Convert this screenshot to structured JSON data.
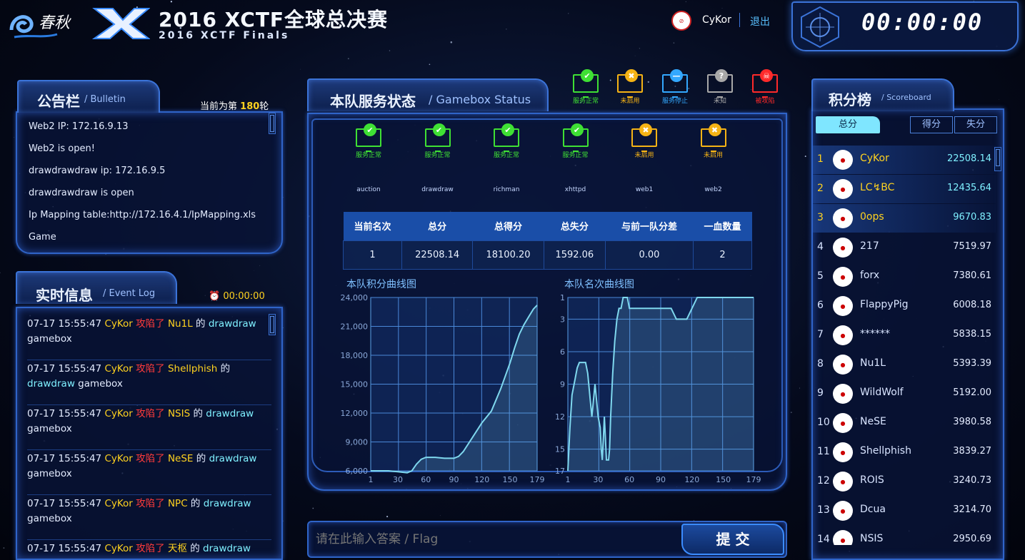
{
  "header": {
    "title": "2016 XCTF全球总决赛",
    "subtitle": "2016 XCTF Finals",
    "logo_text": "春秋",
    "user": "CyKor",
    "logout": "退出",
    "timer": "00:00:00"
  },
  "bulletin": {
    "title": "公告栏",
    "title_en": "Bulletin",
    "round_prefix": "当前为第",
    "round": "180",
    "round_suffix": "轮",
    "items": [
      "Web2 IP: 172.16.9.13",
      "Web2 is open!",
      "drawdrawdraw ip: 172.16.9.5",
      "drawdrawdraw is open",
      "Ip Mapping table:http://172.16.4.1/IpMapping.xls",
      "Game"
    ]
  },
  "eventlog": {
    "title": "实时信息",
    "title_en": "Event Log",
    "clock": "00:00:00",
    "verb": "攻陷了",
    "of": "的",
    "items": [
      {
        "time": "07-17 15:55:47",
        "attacker": "CyKor",
        "victim": "Nu1L",
        "service": "drawdraw",
        "tail": "gamebox"
      },
      {
        "time": "07-17 15:55:47",
        "attacker": "CyKor",
        "victim": "Shellphish",
        "service": "drawdraw",
        "tail": "gamebox"
      },
      {
        "time": "07-17 15:55:47",
        "attacker": "CyKor",
        "victim": "NSIS",
        "service": "drawdraw",
        "tail": "gamebox"
      },
      {
        "time": "07-17 15:55:47",
        "attacker": "CyKor",
        "victim": "NeSE",
        "service": "drawdraw",
        "tail": "gamebox"
      },
      {
        "time": "07-17 15:55:47",
        "attacker": "CyKor",
        "victim": "NPC",
        "service": "drawdraw",
        "tail": "gamebox"
      },
      {
        "time": "07-17 15:55:47",
        "attacker": "CyKor",
        "victim": "天枢",
        "service": "drawdraw",
        "tail": ""
      }
    ]
  },
  "legend": [
    {
      "label": "服务正常",
      "color": "#3fe034",
      "icon": "check-icon"
    },
    {
      "label": "未启用",
      "color": "#f5b315",
      "icon": "cross-icon"
    },
    {
      "label": "服务停止",
      "color": "#33a8ff",
      "icon": "minus-icon"
    },
    {
      "label": "未知",
      "color": "#a8a8a8",
      "icon": "question-icon"
    },
    {
      "label": "被攻陷",
      "color": "#ff2a2a",
      "icon": "skull-icon"
    }
  ],
  "gamebox": {
    "title": "本队服务状态",
    "title_en": "Gamebox Status",
    "services": [
      {
        "name": "auction",
        "status": "服务正常",
        "color": "#3fe034",
        "icon": "check-icon"
      },
      {
        "name": "drawdraw",
        "status": "服务正常",
        "color": "#3fe034",
        "icon": "check-icon"
      },
      {
        "name": "richman",
        "status": "服务正常",
        "color": "#3fe034",
        "icon": "check-icon"
      },
      {
        "name": "xhttpd",
        "status": "服务正常",
        "color": "#3fe034",
        "icon": "check-icon"
      },
      {
        "name": "web1",
        "status": "未启用",
        "color": "#f5b315",
        "icon": "cross-icon"
      },
      {
        "name": "web2",
        "status": "未启用",
        "color": "#f5b315",
        "icon": "cross-icon"
      }
    ],
    "table": {
      "headers": [
        "当前名次",
        "总分",
        "总得分",
        "总失分",
        "与前一队分差",
        "一血数量"
      ],
      "values": [
        "1",
        "22508.14",
        "18100.20",
        "1592.06",
        "0.00",
        "2"
      ]
    }
  },
  "chart_data": [
    {
      "type": "area",
      "title": "本队积分曲线图",
      "x_ticks": [
        "1",
        "30",
        "60",
        "90",
        "120",
        "150",
        "179"
      ],
      "y_ticks": [
        "6,000",
        "9,000",
        "12,000",
        "15,000",
        "18,000",
        "21,000",
        "24,000"
      ],
      "xlim": [
        1,
        179
      ],
      "ylim": [
        6000,
        24000
      ],
      "x": [
        1,
        10,
        20,
        30,
        40,
        45,
        50,
        55,
        60,
        70,
        80,
        90,
        95,
        100,
        110,
        120,
        130,
        140,
        150,
        155,
        160,
        165,
        170,
        175,
        179
      ],
      "y": [
        6000,
        6000,
        6000,
        5900,
        5800,
        6000,
        6700,
        7200,
        7400,
        7400,
        7300,
        7300,
        7500,
        8000,
        9500,
        11000,
        12200,
        14500,
        17200,
        18800,
        20200,
        21200,
        22000,
        22800,
        23200
      ]
    },
    {
      "type": "area",
      "title": "本队名次曲线图",
      "x_ticks": [
        "1",
        "30",
        "60",
        "90",
        "120",
        "150",
        "179"
      ],
      "y_ticks": [
        "1",
        "3",
        "6",
        "9",
        "12",
        "15",
        "17"
      ],
      "xlim": [
        1,
        179
      ],
      "ylim": [
        17,
        1
      ],
      "x": [
        1,
        3,
        5,
        8,
        10,
        12,
        15,
        18,
        20,
        24,
        25,
        27,
        30,
        32,
        33,
        34,
        35,
        36,
        37,
        38,
        39,
        40,
        41,
        42,
        44,
        46,
        48,
        50,
        52,
        54,
        56,
        58,
        60,
        65,
        70,
        75,
        80,
        85,
        90,
        95,
        100,
        105,
        110,
        115,
        120,
        125,
        130,
        140,
        150,
        160,
        170,
        179
      ],
      "y": [
        17,
        13,
        10,
        8.5,
        7.5,
        7,
        7,
        7,
        8,
        12,
        11,
        9,
        12,
        13,
        15,
        16,
        14,
        12,
        14,
        16,
        16,
        16,
        15,
        12,
        8,
        5,
        3,
        2,
        2,
        1,
        1,
        1,
        2,
        2,
        2,
        2,
        2,
        2,
        2,
        2,
        2,
        3,
        3,
        3,
        2,
        1,
        1,
        1,
        1,
        1,
        1,
        1
      ]
    }
  ],
  "flag": {
    "placeholder": "请在此输入答案 / Flag",
    "submit": "提 交"
  },
  "scoreboard": {
    "title": "积分榜",
    "title_en": "Scoreboard",
    "tabs": [
      "总分",
      "得分",
      "失分"
    ],
    "teams": [
      {
        "rank": "1",
        "name": "CyKor",
        "score": "22508.14"
      },
      {
        "rank": "2",
        "name": "LC↯BC",
        "score": "12435.64"
      },
      {
        "rank": "3",
        "name": "0ops",
        "score": "9670.83"
      },
      {
        "rank": "4",
        "name": "217",
        "score": "7519.97"
      },
      {
        "rank": "5",
        "name": "forx",
        "score": "7380.61"
      },
      {
        "rank": "6",
        "name": "FlappyPig",
        "score": "6008.18"
      },
      {
        "rank": "7",
        "name": "******",
        "score": "5838.15"
      },
      {
        "rank": "8",
        "name": "Nu1L",
        "score": "5393.39"
      },
      {
        "rank": "9",
        "name": "WildWolf",
        "score": "5192.00"
      },
      {
        "rank": "10",
        "name": "NeSE",
        "score": "3980.58"
      },
      {
        "rank": "11",
        "name": "Shellphish",
        "score": "3839.27"
      },
      {
        "rank": "12",
        "name": "ROIS",
        "score": "3240.73"
      },
      {
        "rank": "13",
        "name": "Dcua",
        "score": "3214.70"
      },
      {
        "rank": "14",
        "name": "NSIS",
        "score": "2950.69"
      }
    ]
  }
}
